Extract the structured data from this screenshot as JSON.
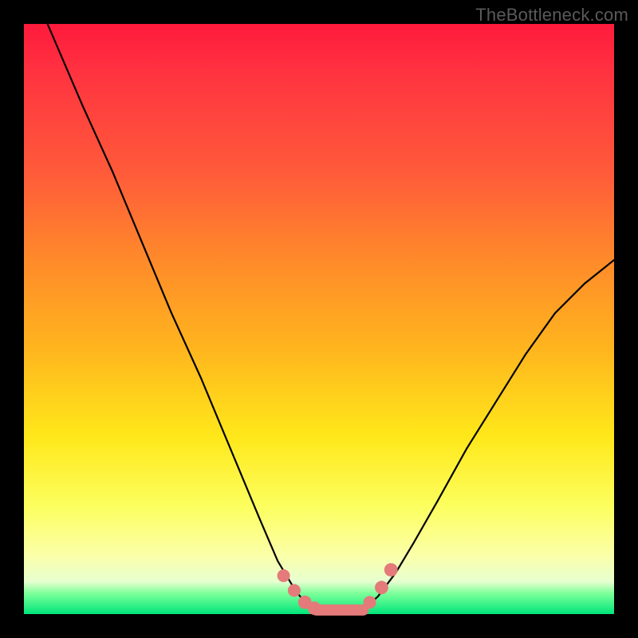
{
  "watermark": "TheBottleneck.com",
  "colors": {
    "background": "#000000",
    "curve": "#000000",
    "marker_fill": "#e47a7a",
    "marker_stroke": "#d85f5f",
    "gradient_stops": [
      "#ff1a3c",
      "#ff5a3a",
      "#ffb51e",
      "#ffe81a",
      "#fbffa8",
      "#00e67a"
    ]
  },
  "chart_data": {
    "type": "line",
    "title": "",
    "xlabel": "",
    "ylabel": "",
    "xlim": [
      0,
      100
    ],
    "ylim": [
      0,
      100
    ],
    "grid": false,
    "legend": false,
    "note": "Values are estimated from pixels; y=0 is bottom (green), y=100 is top (red). Curve is a V shape with a flat trough near x≈48–58.",
    "series": [
      {
        "name": "bottleneck-curve",
        "x": [
          4,
          10,
          15,
          20,
          25,
          30,
          35,
          40,
          43,
          46,
          48,
          50,
          53,
          56,
          58,
          60,
          63,
          66,
          70,
          75,
          80,
          85,
          90,
          95,
          100
        ],
        "y": [
          100,
          86,
          75,
          63,
          51,
          40,
          28,
          16,
          9,
          4,
          1.5,
          0.8,
          0.6,
          0.6,
          1.2,
          3,
          7,
          12,
          19,
          28,
          36,
          44,
          51,
          56,
          60
        ]
      }
    ],
    "markers": {
      "name": "trough-markers",
      "style": "rounded",
      "points": [
        {
          "x": 44.0,
          "y": 6.5,
          "r": 1.0
        },
        {
          "x": 45.8,
          "y": 4.0,
          "r": 1.0
        },
        {
          "x": 47.6,
          "y": 2.0,
          "r": 1.2
        },
        {
          "x": 49.2,
          "y": 1.0,
          "r": 1.2
        },
        {
          "x": 58.6,
          "y": 2.0,
          "r": 1.0
        },
        {
          "x": 60.6,
          "y": 4.5,
          "r": 1.2
        },
        {
          "x": 62.2,
          "y": 7.5,
          "r": 1.2
        }
      ],
      "trough_bar": {
        "x0": 49.5,
        "x1": 57.5,
        "y": 0.7,
        "thickness": 2.2
      }
    }
  }
}
